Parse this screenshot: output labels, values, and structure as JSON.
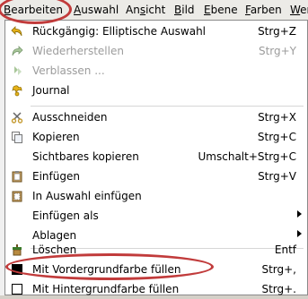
{
  "menubar": {
    "items": [
      {
        "label": "Bearbeiten",
        "key": "B",
        "rest": "earbeiten"
      },
      {
        "label": "Auswahl",
        "key": "A",
        "rest": "uswahl"
      },
      {
        "label": "Ansicht",
        "pre": "An",
        "key": "s",
        "rest": "icht"
      },
      {
        "label": "Bild",
        "key": "B",
        "rest": "ild"
      },
      {
        "label": "Ebene",
        "key": "E",
        "rest": "bene"
      },
      {
        "label": "Farben",
        "key": "F",
        "rest": "arben"
      },
      {
        "label": "Wer",
        "key": "W",
        "rest": "er"
      }
    ]
  },
  "menu": {
    "items": [
      {
        "label": "Rückgängig: Elliptische Auswahl",
        "shortcut": "Strg+Z",
        "icon": "undo-icon",
        "disabled": false
      },
      {
        "label": "Wiederherstellen",
        "shortcut": "Strg+Y",
        "icon": "redo-icon",
        "disabled": true
      },
      {
        "label": "Verblassen ...",
        "shortcut": "",
        "icon": "fade-icon",
        "disabled": true
      },
      {
        "label": "Journal",
        "shortcut": "",
        "icon": "journal-icon",
        "disabled": false
      },
      {
        "label": "Ausschneiden",
        "shortcut": "Strg+X",
        "icon": "cut-icon",
        "disabled": false
      },
      {
        "label": "Kopieren",
        "shortcut": "Strg+C",
        "icon": "copy-icon",
        "disabled": false
      },
      {
        "label": "Sichtbares kopieren",
        "shortcut": "Umschalt+Strg+C",
        "icon": "",
        "disabled": false
      },
      {
        "label": "Einfügen",
        "shortcut": "Strg+V",
        "icon": "paste-icon",
        "disabled": false
      },
      {
        "label": "In Auswahl einfügen",
        "shortcut": "",
        "icon": "paste-into-icon",
        "disabled": false
      },
      {
        "label": "Einfügen als",
        "shortcut": "",
        "icon": "",
        "disabled": false,
        "submenu": true
      },
      {
        "label": "Ablagen",
        "shortcut": "",
        "icon": "",
        "disabled": false,
        "submenu": true
      },
      {
        "label": "Löschen",
        "shortcut": "Entf",
        "icon": "clear-icon",
        "disabled": false
      },
      {
        "label": "Mit Vordergrundfarbe füllen",
        "shortcut": "Strg+,",
        "icon": "fg-fill-icon",
        "disabled": false
      },
      {
        "label": "Mit Hintergrundfarbe füllen",
        "shortcut": "Strg+.",
        "icon": "bg-fill-icon",
        "disabled": false
      }
    ]
  },
  "colors": {
    "highlight": "#c13b3b",
    "disabled_text": "#9c9c9c"
  }
}
